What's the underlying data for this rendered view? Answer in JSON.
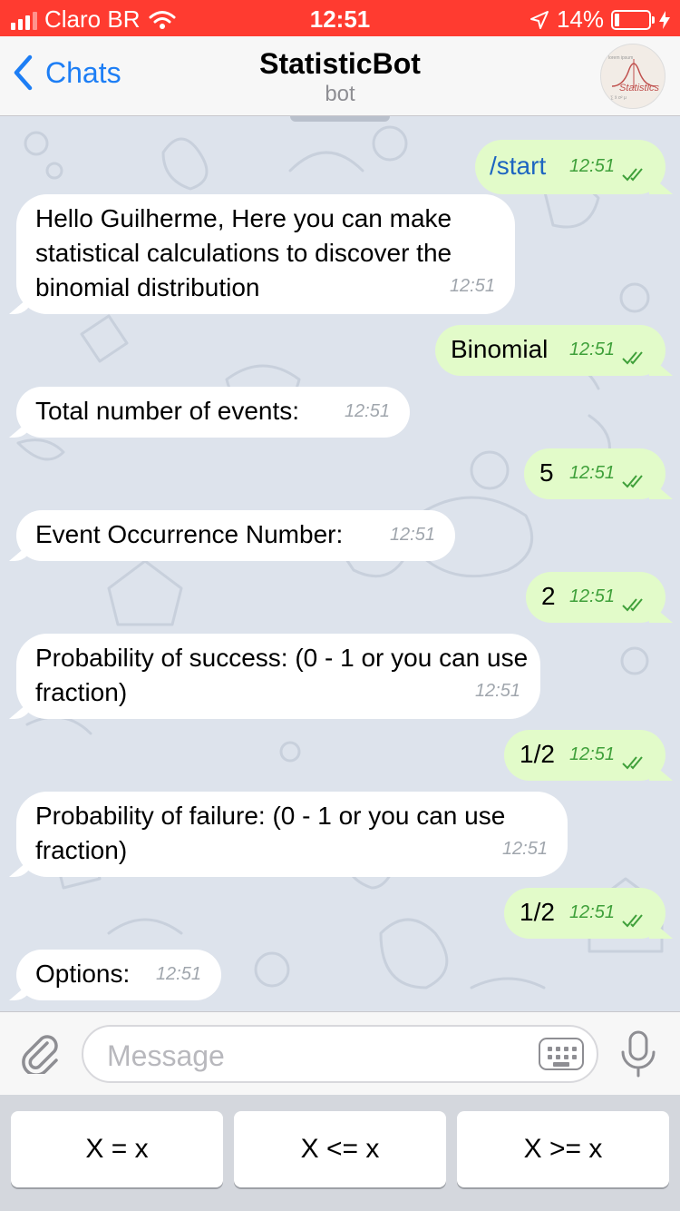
{
  "status_bar": {
    "carrier": "Claro BR",
    "time": "12:51",
    "battery": "14%",
    "battery_level": 0.14
  },
  "header": {
    "back_label": "Chats",
    "title": "StatisticBot",
    "subtitle": "bot",
    "avatar_text": "Statistics"
  },
  "messages": [
    {
      "dir": "out",
      "text": "/start",
      "time": "12:51"
    },
    {
      "dir": "in",
      "text": "Hello Guilherme, Here you can make statistical calculations to discover the binomial distribution",
      "time": "12:51"
    },
    {
      "dir": "out",
      "text": "Binomial",
      "time": "12:51"
    },
    {
      "dir": "in",
      "text": "Total number of events:",
      "time": "12:51"
    },
    {
      "dir": "out",
      "text": "5",
      "time": "12:51"
    },
    {
      "dir": "in",
      "text": "Event Occurrence Number:",
      "time": "12:51"
    },
    {
      "dir": "out",
      "text": "2",
      "time": "12:51"
    },
    {
      "dir": "in",
      "text": "Probability of success: (0 - 1 or you can use fraction)",
      "time": "12:51"
    },
    {
      "dir": "out",
      "text": "1/2",
      "time": "12:51"
    },
    {
      "dir": "in",
      "text": "Probability of failure: (0 - 1 or you can use fraction)",
      "time": "12:51"
    },
    {
      "dir": "out",
      "text": "1/2",
      "time": "12:51"
    },
    {
      "dir": "in",
      "text": "Options:",
      "time": "12:51"
    }
  ],
  "input": {
    "placeholder": "Message"
  },
  "keyboard": {
    "buttons": [
      "X = x",
      "X <= x",
      "X >= x"
    ]
  },
  "colors": {
    "status_bar": "#ff3b30",
    "accent": "#1d7ef5",
    "outgoing_bubble": "#e2fbc9",
    "incoming_bubble": "#ffffff",
    "chat_background": "#dde3ec"
  }
}
